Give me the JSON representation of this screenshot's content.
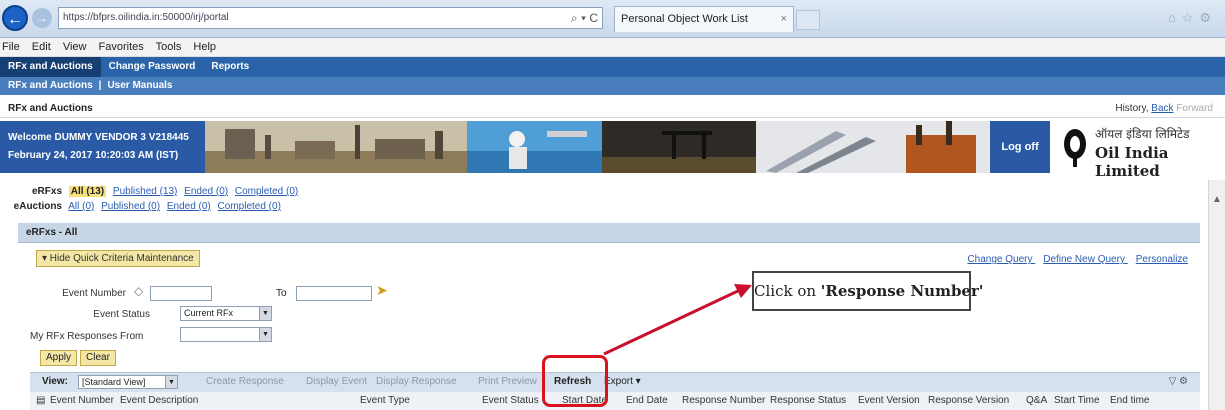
{
  "browser": {
    "url": "https://bfprs.oilindia.in:50000/irj/portal",
    "tab_title": "Personal Object Work List",
    "addr_controls": "⌕ ▾ C",
    "tab_close": "×"
  },
  "menu": [
    "File",
    "Edit",
    "View",
    "Favorites",
    "Tools",
    "Help"
  ],
  "portal": {
    "tabs": [
      "RFx and Auctions",
      "Change Password",
      "Reports"
    ],
    "subnav": [
      "RFx and Auctions",
      "User Manuals"
    ],
    "subnav_sep": "|",
    "page_title": "RFx and Auctions",
    "history": "History",
    "back": "Back",
    "forward": "Forward"
  },
  "banner": {
    "welcome": "Welcome DUMMY VENDOR 3 V218445",
    "date": "February 24, 2017 10:20:03 AM (IST)",
    "logoff": "Log off",
    "company_hindi": "ऑयल इंडिया लिमिटेड",
    "company_en": "Oil India Limited"
  },
  "filters": {
    "erfx_label": "eRFxs",
    "erfx_links": [
      "All (13)",
      "Published (13)",
      "Ended (0)",
      "Completed (0)"
    ],
    "eauctions_label": "eAuctions",
    "eauction_links": [
      "All (0)",
      "Published (0)",
      "Ended (0)",
      "Completed (0)"
    ]
  },
  "section_title": "eRFxs - All",
  "quick_criteria": {
    "hide_label": "▾ Hide Quick Criteria Maintenance",
    "links": [
      "Change Query",
      "Define New Query",
      "Personalize"
    ]
  },
  "form": {
    "event_number_label": "Event Number",
    "to_label": "To",
    "event_status_label": "Event Status",
    "event_status_value": "Current RFx",
    "responses_label": "My RFx Responses From",
    "responses_value": "",
    "apply": "Apply",
    "clear": "Clear"
  },
  "callout": {
    "prefix": "Click on ",
    "emphasis": "'Response Number'"
  },
  "toolbar": {
    "view_label": "View:",
    "view_value": "[Standard View]",
    "create_response": "Create Response",
    "display_event": "Display Event",
    "display_response": "Display Response",
    "print_preview": "Print Preview",
    "refresh": "Refresh",
    "export": "Export ▾",
    "icons": "▽ ⚙"
  },
  "columns": [
    "Event Number",
    "Event Description",
    "Event Type",
    "Event Status",
    "Start Date",
    "End Date",
    "Response Number",
    "Response Status",
    "Event Version",
    "Response Version",
    "Q&A",
    "Start Time",
    "End time"
  ],
  "colors": {
    "highlight_box": "#d9121e",
    "arrow": "#c8102e",
    "portal_blue": "#2a63a8"
  }
}
